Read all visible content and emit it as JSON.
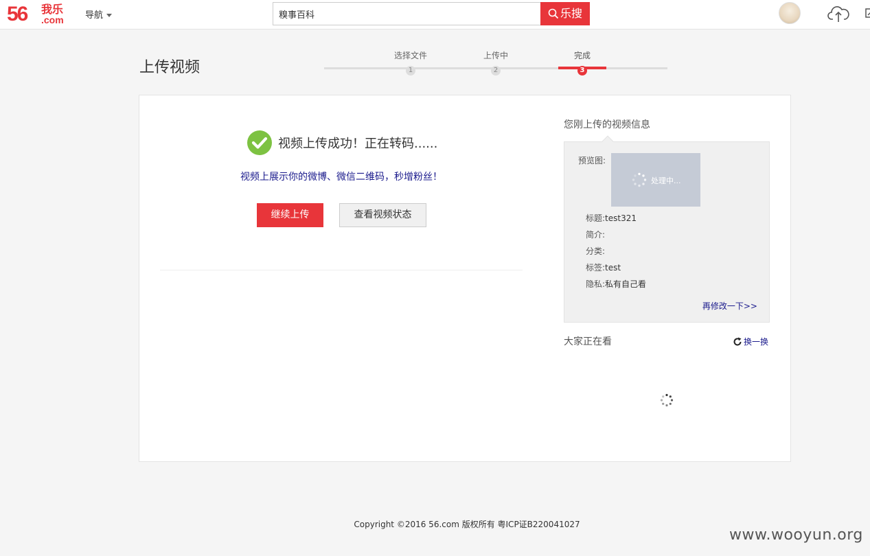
{
  "header": {
    "logo_num": "56",
    "logo_cn": "我乐",
    "logo_com": ".com",
    "nav_label": "导航",
    "search_value": "糗事百科",
    "search_button": "乐搜"
  },
  "page": {
    "title": "上传视频",
    "steps": [
      {
        "label": "选择文件",
        "num": "1"
      },
      {
        "label": "上传中",
        "num": "2"
      },
      {
        "label": "完成",
        "num": "3"
      }
    ]
  },
  "main": {
    "success_message": "视频上传成功！正在转码......",
    "promo": "视频上展示你的微博、微信二维码，秒增粉丝！",
    "continue_button": "继续上传",
    "status_button": "查看视频状态"
  },
  "info": {
    "title": "您刚上传的视频信息",
    "preview_label": "预览图:",
    "processing": "处理中...",
    "rows": [
      {
        "key": "标题:",
        "value": "test321"
      },
      {
        "key": "简介:",
        "value": ""
      },
      {
        "key": "分类:",
        "value": ""
      },
      {
        "key": "标签:",
        "value": "test"
      },
      {
        "key": "隐私:",
        "value": "私有自己看"
      }
    ],
    "edit_link": "再修改一下>>"
  },
  "watching": {
    "title": "大家正在看",
    "refresh": "换一换"
  },
  "footer": {
    "copyright": "Copyright ©2016 56.com 版权所有 粤ICP证B220041027"
  },
  "watermark": "www.wooyun.org",
  "colors": {
    "brand_red": "#e8353a",
    "link_blue": "#1a1a8c",
    "success_green": "#7dc242"
  }
}
